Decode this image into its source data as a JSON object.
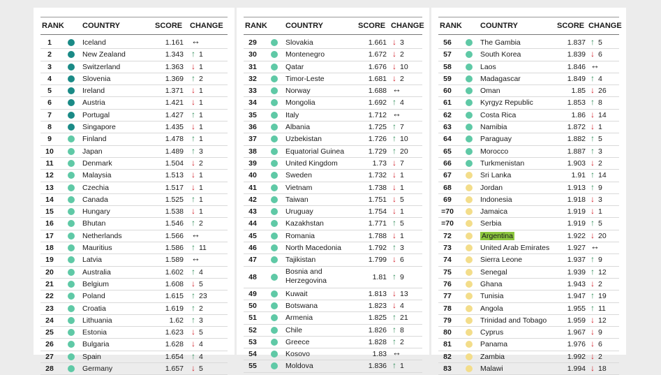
{
  "headers": {
    "rank": "RANK",
    "country": "COUNTRY",
    "score": "SCORE",
    "change": "CHANGE"
  },
  "colors": {
    "tier1": "#1a8a86",
    "tier2": "#5fc9a6",
    "tier3": "#f3dd8a",
    "highlight": "#8cc63f",
    "up": "#2e8b57",
    "down": "#d3202a"
  },
  "columns": [
    [
      {
        "rank": "1",
        "country": "Iceland",
        "score": "1.161",
        "dir": "flat",
        "change": "",
        "tier": 1
      },
      {
        "rank": "2",
        "country": "New Zealand",
        "score": "1.343",
        "dir": "up",
        "change": "1",
        "tier": 1
      },
      {
        "rank": "3",
        "country": "Switzerland",
        "score": "1.363",
        "dir": "down",
        "change": "1",
        "tier": 1
      },
      {
        "rank": "4",
        "country": "Slovenia",
        "score": "1.369",
        "dir": "up",
        "change": "2",
        "tier": 1
      },
      {
        "rank": "5",
        "country": "Ireland",
        "score": "1.371",
        "dir": "down",
        "change": "1",
        "tier": 1
      },
      {
        "rank": "6",
        "country": "Austria",
        "score": "1.421",
        "dir": "down",
        "change": "1",
        "tier": 1
      },
      {
        "rank": "7",
        "country": "Portugal",
        "score": "1.427",
        "dir": "up",
        "change": "1",
        "tier": 1
      },
      {
        "rank": "8",
        "country": "Singapore",
        "score": "1.435",
        "dir": "down",
        "change": "1",
        "tier": 1
      },
      {
        "rank": "9",
        "country": "Finland",
        "score": "1.478",
        "dir": "up",
        "change": "1",
        "tier": 2
      },
      {
        "rank": "10",
        "country": "Japan",
        "score": "1.489",
        "dir": "up",
        "change": "3",
        "tier": 2
      },
      {
        "rank": "11",
        "country": "Denmark",
        "score": "1.504",
        "dir": "down",
        "change": "2",
        "tier": 2
      },
      {
        "rank": "12",
        "country": "Malaysia",
        "score": "1.513",
        "dir": "down",
        "change": "1",
        "tier": 2
      },
      {
        "rank": "13",
        "country": "Czechia",
        "score": "1.517",
        "dir": "down",
        "change": "1",
        "tier": 2
      },
      {
        "rank": "14",
        "country": "Canada",
        "score": "1.525",
        "dir": "up",
        "change": "1",
        "tier": 2
      },
      {
        "rank": "15",
        "country": "Hungary",
        "score": "1.538",
        "dir": "down",
        "change": "1",
        "tier": 2
      },
      {
        "rank": "16",
        "country": "Bhutan",
        "score": "1.546",
        "dir": "up",
        "change": "2",
        "tier": 2
      },
      {
        "rank": "17",
        "country": "Netherlands",
        "score": "1.566",
        "dir": "flat",
        "change": "",
        "tier": 2
      },
      {
        "rank": "18",
        "country": "Mauritius",
        "score": "1.586",
        "dir": "up",
        "change": "11",
        "tier": 2
      },
      {
        "rank": "19",
        "country": "Latvia",
        "score": "1.589",
        "dir": "flat",
        "change": "",
        "tier": 2
      },
      {
        "rank": "20",
        "country": "Australia",
        "score": "1.602",
        "dir": "up",
        "change": "4",
        "tier": 2
      },
      {
        "rank": "21",
        "country": "Belgium",
        "score": "1.608",
        "dir": "down",
        "change": "5",
        "tier": 2
      },
      {
        "rank": "22",
        "country": "Poland",
        "score": "1.615",
        "dir": "up",
        "change": "23",
        "tier": 2
      },
      {
        "rank": "23",
        "country": "Croatia",
        "score": "1.619",
        "dir": "up",
        "change": "2",
        "tier": 2
      },
      {
        "rank": "24",
        "country": "Lithuania",
        "score": "1.62",
        "dir": "up",
        "change": "3",
        "tier": 2
      },
      {
        "rank": "25",
        "country": "Estonia",
        "score": "1.623",
        "dir": "down",
        "change": "5",
        "tier": 2
      },
      {
        "rank": "26",
        "country": "Bulgaria",
        "score": "1.628",
        "dir": "down",
        "change": "4",
        "tier": 2
      },
      {
        "rank": "27",
        "country": "Spain",
        "score": "1.654",
        "dir": "up",
        "change": "4",
        "tier": 2
      },
      {
        "rank": "28",
        "country": "Germany",
        "score": "1.657",
        "dir": "down",
        "change": "5",
        "tier": 2
      }
    ],
    [
      {
        "rank": "29",
        "country": "Slovakia",
        "score": "1.661",
        "dir": "down",
        "change": "3",
        "tier": 2
      },
      {
        "rank": "30",
        "country": "Montenegro",
        "score": "1.672",
        "dir": "down",
        "change": "2",
        "tier": 2
      },
      {
        "rank": "31",
        "country": "Qatar",
        "score": "1.676",
        "dir": "down",
        "change": "10",
        "tier": 2
      },
      {
        "rank": "32",
        "country": "Timor-Leste",
        "score": "1.681",
        "dir": "down",
        "change": "2",
        "tier": 2
      },
      {
        "rank": "33",
        "country": "Norway",
        "score": "1.688",
        "dir": "flat",
        "change": "",
        "tier": 2
      },
      {
        "rank": "34",
        "country": "Mongolia",
        "score": "1.692",
        "dir": "up",
        "change": "4",
        "tier": 2
      },
      {
        "rank": "35",
        "country": "Italy",
        "score": "1.712",
        "dir": "flat",
        "change": "",
        "tier": 2
      },
      {
        "rank": "36",
        "country": "Albania",
        "score": "1.725",
        "dir": "up",
        "change": "7",
        "tier": 2
      },
      {
        "rank": "37",
        "country": "Uzbekistan",
        "score": "1.726",
        "dir": "up",
        "change": "10",
        "tier": 2
      },
      {
        "rank": "38",
        "country": "Equatorial Guinea",
        "score": "1.729",
        "dir": "up",
        "change": "20",
        "tier": 2
      },
      {
        "rank": "39",
        "country": "United Kingdom",
        "score": "1.73",
        "dir": "down",
        "change": "7",
        "tier": 2
      },
      {
        "rank": "40",
        "country": "Sweden",
        "score": "1.732",
        "dir": "down",
        "change": "1",
        "tier": 2
      },
      {
        "rank": "41",
        "country": "Vietnam",
        "score": "1.738",
        "dir": "down",
        "change": "1",
        "tier": 2
      },
      {
        "rank": "42",
        "country": "Taiwan",
        "score": "1.751",
        "dir": "down",
        "change": "5",
        "tier": 2
      },
      {
        "rank": "43",
        "country": "Uruguay",
        "score": "1.754",
        "dir": "down",
        "change": "1",
        "tier": 2
      },
      {
        "rank": "44",
        "country": "Kazakhstan",
        "score": "1.771",
        "dir": "up",
        "change": "5",
        "tier": 2
      },
      {
        "rank": "45",
        "country": "Romania",
        "score": "1.788",
        "dir": "down",
        "change": "1",
        "tier": 2
      },
      {
        "rank": "46",
        "country": "North Macedonia",
        "score": "1.792",
        "dir": "up",
        "change": "3",
        "tier": 2
      },
      {
        "rank": "47",
        "country": "Tajikistan",
        "score": "1.799",
        "dir": "down",
        "change": "6",
        "tier": 2
      },
      {
        "rank": "48",
        "country": "Bosnia and Herzegovina",
        "score": "1.81",
        "dir": "up",
        "change": "9",
        "tier": 2,
        "tall": true
      },
      {
        "rank": "49",
        "country": "Kuwait",
        "score": "1.813",
        "dir": "down",
        "change": "13",
        "tier": 2
      },
      {
        "rank": "50",
        "country": "Botswana",
        "score": "1.823",
        "dir": "down",
        "change": "4",
        "tier": 2
      },
      {
        "rank": "51",
        "country": "Armenia",
        "score": "1.825",
        "dir": "up",
        "change": "21",
        "tier": 2
      },
      {
        "rank": "52",
        "country": "Chile",
        "score": "1.826",
        "dir": "up",
        "change": "8",
        "tier": 2
      },
      {
        "rank": "53",
        "country": "Greece",
        "score": "1.828",
        "dir": "up",
        "change": "2",
        "tier": 2
      },
      {
        "rank": "54",
        "country": "Kosovo",
        "score": "1.83",
        "dir": "flat",
        "change": "",
        "tier": 2
      },
      {
        "rank": "55",
        "country": "Moldova",
        "score": "1.836",
        "dir": "up",
        "change": "1",
        "tier": 2
      }
    ],
    [
      {
        "rank": "56",
        "country": "The Gambia",
        "score": "1.837",
        "dir": "up",
        "change": "5",
        "tier": 2
      },
      {
        "rank": "57",
        "country": "South Korea",
        "score": "1.839",
        "dir": "down",
        "change": "6",
        "tier": 2
      },
      {
        "rank": "58",
        "country": "Laos",
        "score": "1.846",
        "dir": "flat",
        "change": "",
        "tier": 2
      },
      {
        "rank": "59",
        "country": "Madagascar",
        "score": "1.849",
        "dir": "up",
        "change": "4",
        "tier": 2
      },
      {
        "rank": "60",
        "country": "Oman",
        "score": "1.85",
        "dir": "down",
        "change": "26",
        "tier": 2
      },
      {
        "rank": "61",
        "country": "Kyrgyz Republic",
        "score": "1.853",
        "dir": "up",
        "change": "8",
        "tier": 2
      },
      {
        "rank": "62",
        "country": "Costa Rica",
        "score": "1.86",
        "dir": "down",
        "change": "14",
        "tier": 2
      },
      {
        "rank": "63",
        "country": "Namibia",
        "score": "1.872",
        "dir": "down",
        "change": "1",
        "tier": 2
      },
      {
        "rank": "64",
        "country": "Paraguay",
        "score": "1.882",
        "dir": "up",
        "change": "5",
        "tier": 2
      },
      {
        "rank": "65",
        "country": "Morocco",
        "score": "1.887",
        "dir": "up",
        "change": "3",
        "tier": 2
      },
      {
        "rank": "66",
        "country": "Turkmenistan",
        "score": "1.903",
        "dir": "down",
        "change": "2",
        "tier": 2
      },
      {
        "rank": "67",
        "country": "Sri Lanka",
        "score": "1.91",
        "dir": "up",
        "change": "14",
        "tier": 3
      },
      {
        "rank": "68",
        "country": "Jordan",
        "score": "1.913",
        "dir": "up",
        "change": "9",
        "tier": 3
      },
      {
        "rank": "69",
        "country": "Indonesia",
        "score": "1.918",
        "dir": "down",
        "change": "3",
        "tier": 3
      },
      {
        "rank": "=70",
        "country": "Jamaica",
        "score": "1.919",
        "dir": "down",
        "change": "1",
        "tier": 3
      },
      {
        "rank": "=70",
        "country": "Serbia",
        "score": "1.919",
        "dir": "up",
        "change": "5",
        "tier": 3
      },
      {
        "rank": "72",
        "country": "Argentina",
        "score": "1.922",
        "dir": "down",
        "change": "20",
        "tier": 3,
        "highlight": true
      },
      {
        "rank": "73",
        "country": "United Arab Emirates",
        "score": "1.927",
        "dir": "flat",
        "change": "",
        "tier": 3
      },
      {
        "rank": "74",
        "country": "Sierra Leone",
        "score": "1.937",
        "dir": "up",
        "change": "9",
        "tier": 3
      },
      {
        "rank": "75",
        "country": "Senegal",
        "score": "1.939",
        "dir": "up",
        "change": "12",
        "tier": 3
      },
      {
        "rank": "76",
        "country": "Ghana",
        "score": "1.943",
        "dir": "down",
        "change": "2",
        "tier": 3
      },
      {
        "rank": "77",
        "country": "Tunisia",
        "score": "1.947",
        "dir": "up",
        "change": "19",
        "tier": 3
      },
      {
        "rank": "78",
        "country": "Angola",
        "score": "1.955",
        "dir": "up",
        "change": "11",
        "tier": 3
      },
      {
        "rank": "79",
        "country": "Trinidad and Tobago",
        "score": "1.959",
        "dir": "down",
        "change": "12",
        "tier": 3
      },
      {
        "rank": "80",
        "country": "Cyprus",
        "score": "1.967",
        "dir": "down",
        "change": "9",
        "tier": 3
      },
      {
        "rank": "81",
        "country": "Panama",
        "score": "1.976",
        "dir": "down",
        "change": "6",
        "tier": 3
      },
      {
        "rank": "82",
        "country": "Zambia",
        "score": "1.992",
        "dir": "down",
        "change": "2",
        "tier": 3
      },
      {
        "rank": "83",
        "country": "Malawi",
        "score": "1.994",
        "dir": "down",
        "change": "18",
        "tier": 3
      }
    ]
  ]
}
